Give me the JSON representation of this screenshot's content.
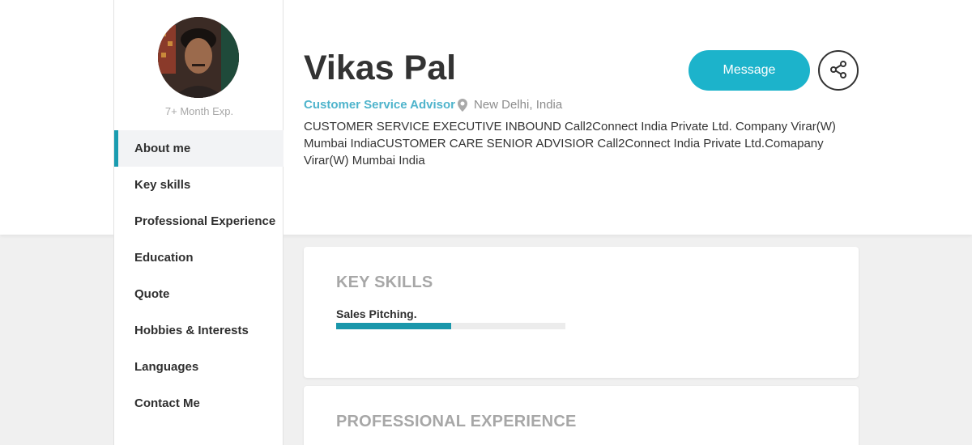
{
  "profile": {
    "name": "Vikas Pal",
    "experience": "7+ Month Exp.",
    "role": "Customer Service Advisor",
    "location": "New Delhi, India",
    "summary": "CUSTOMER SERVICE EXECUTIVE INBOUND Call2Connect India Private Ltd. Company Virar(W) Mumbai IndiaCUSTOMER CARE SENIOR ADVISIOR Call2Connect India Private Ltd.Comapany Virar(W) Mumbai India"
  },
  "actions": {
    "message_label": "Message",
    "share_icon": "share-icon"
  },
  "sidebar": {
    "items": [
      {
        "label": "About me",
        "active": true
      },
      {
        "label": "Key skills",
        "active": false
      },
      {
        "label": "Professional Experience",
        "active": false
      },
      {
        "label": "Education",
        "active": false
      },
      {
        "label": "Quote",
        "active": false
      },
      {
        "label": "Hobbies & Interests",
        "active": false
      },
      {
        "label": "Languages",
        "active": false
      },
      {
        "label": "Contact Me",
        "active": false
      }
    ]
  },
  "key_skills": {
    "title": "KEY SKILLS",
    "skills": [
      {
        "name": "Sales Pitching.",
        "level": 0.5
      }
    ]
  },
  "professional_experience": {
    "title": "PROFESSIONAL EXPERIENCE"
  },
  "colors": {
    "accent": "#1cb3cb",
    "bar_fill": "#1a97ab",
    "role_text": "#4fb4cc"
  }
}
